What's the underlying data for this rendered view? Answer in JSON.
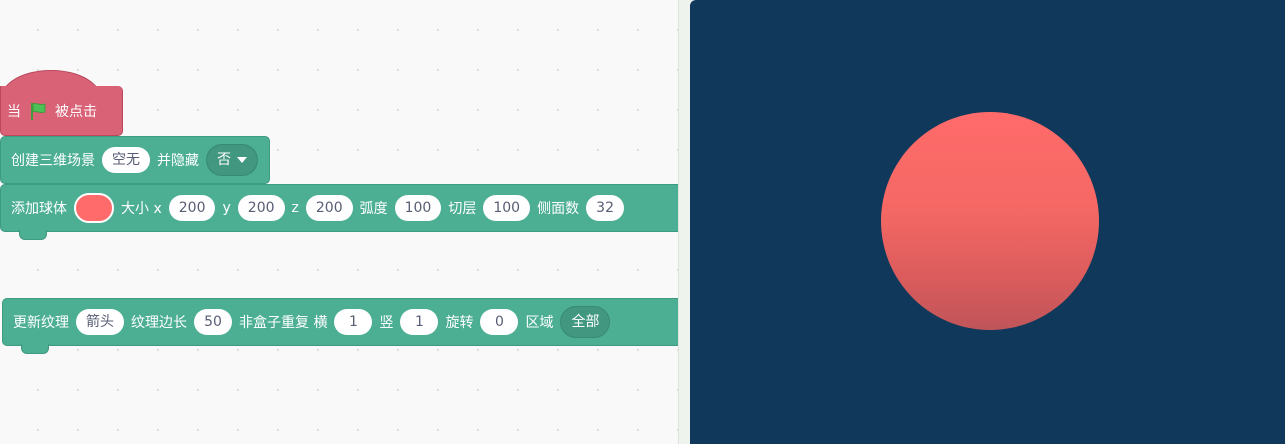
{
  "colors": {
    "event": "#d96277",
    "extension": "#4caf94",
    "stage_bg": "#0f385a",
    "sphere": "#ff6b6a"
  },
  "hat": {
    "label_before": "当",
    "icon": "green-flag-icon",
    "label_after": "被点击"
  },
  "create_scene": {
    "label": "创建三维场景",
    "value": "空无",
    "hide_label": "并隐藏",
    "hide_value": "否"
  },
  "add_sphere": {
    "label": "添加球体",
    "color": "#ff6b6a",
    "size_label": "大小 x",
    "x": "200",
    "y_label": "y",
    "y": "200",
    "z_label": "z",
    "z": "200",
    "arc_label": "弧度",
    "arc": "100",
    "slice_label": "切层",
    "slice": "100",
    "sides_label": "侧面数",
    "sides": "32"
  },
  "update_texture": {
    "label": "更新纹理",
    "texture": "箭头",
    "edge_label": "纹理边长",
    "edge": "50",
    "non_box_label": "非盒子重复 横",
    "h": "1",
    "v_label": "竖",
    "v": "1",
    "rotate_label": "旋转",
    "rotate": "0",
    "area_label": "区域",
    "area": "全部"
  }
}
